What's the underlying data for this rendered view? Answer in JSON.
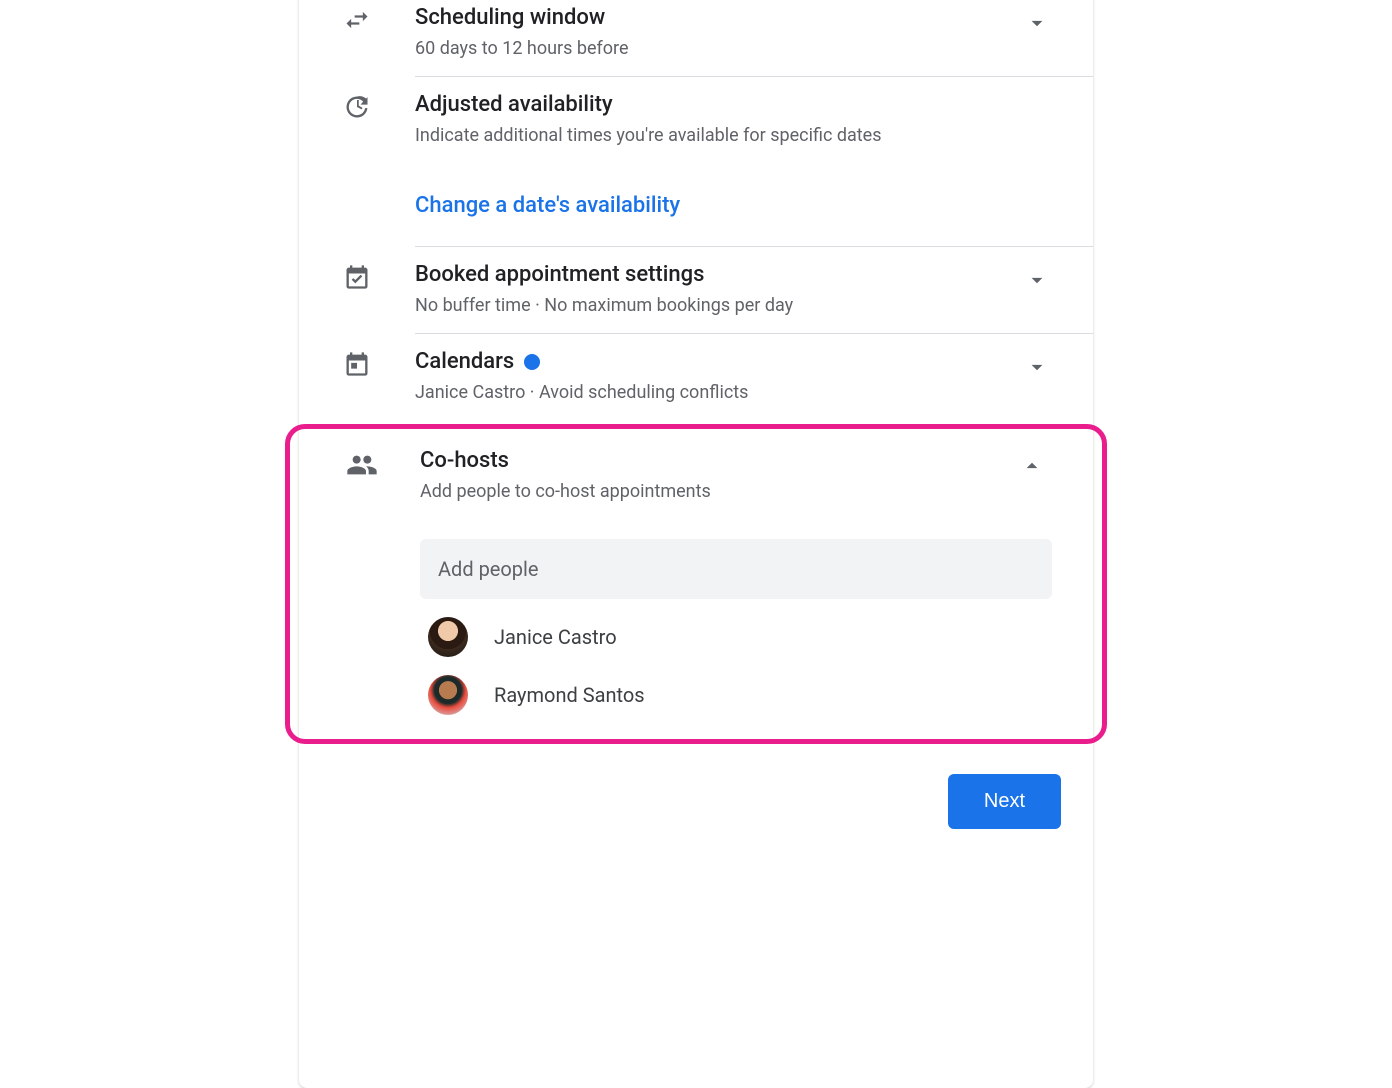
{
  "sections": {
    "scheduling_window": {
      "title": "Scheduling window",
      "subtitle": "60 days to 12 hours before"
    },
    "adjusted_availability": {
      "title": "Adjusted availability",
      "subtitle": "Indicate additional times you're available for specific dates",
      "action_link": "Change a date's availability"
    },
    "booked_appointment": {
      "title": "Booked appointment settings",
      "subtitle": "No buffer time · No maximum bookings per day"
    },
    "calendars": {
      "title": "Calendars",
      "subtitle": "Janice Castro · Avoid scheduling conflicts"
    },
    "cohosts": {
      "title": "Co-hosts",
      "subtitle": "Add people to co-host appointments",
      "input_placeholder": "Add people",
      "people": [
        {
          "name": "Janice Castro"
        },
        {
          "name": "Raymond Santos"
        }
      ]
    }
  },
  "footer": {
    "next_label": "Next"
  }
}
